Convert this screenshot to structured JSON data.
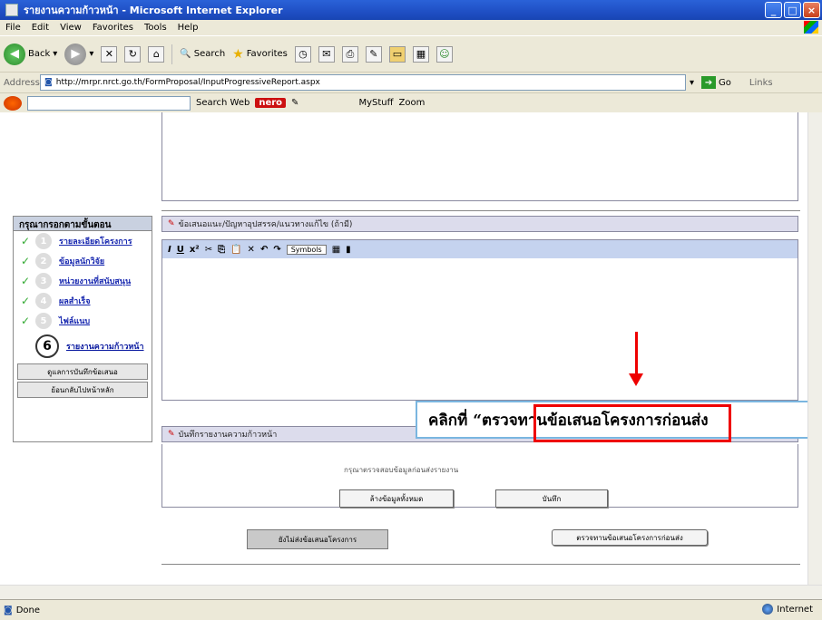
{
  "window": {
    "title": "รายงานความก้าวหน้า - Microsoft Internet Explorer",
    "buttons": [
      "_",
      "□",
      "×"
    ]
  },
  "menu": [
    "File",
    "Edit",
    "View",
    "Favorites",
    "Tools",
    "Help"
  ],
  "toolbar": {
    "back": "Back",
    "search": "Search",
    "favorites": "Favorites"
  },
  "address": {
    "label": "Address",
    "url": "http://mrpr.nrct.go.th/FormProposal/InputProgressiveReport.aspx",
    "go": "Go",
    "links": "Links"
  },
  "searchbar": {
    "search_web": "Search Web",
    "nero": "nero",
    "mystuff": "MyStuff",
    "zoom": "Zoom"
  },
  "steps": {
    "title": "กรุณากรอกตามขั้นตอน",
    "items": [
      {
        "num": "1",
        "label": "รายละเอียดโครงการ"
      },
      {
        "num": "2",
        "label": "ข้อมูลนักวิจัย"
      },
      {
        "num": "3",
        "label": "หน่วยงานที่สนับสนุน"
      },
      {
        "num": "4",
        "label": "ผลสำเร็จ"
      },
      {
        "num": "5",
        "label": "ไฟล์แนบ"
      },
      {
        "num": "6",
        "label": "รายงานความก้าวหน้า"
      }
    ],
    "btn_save_all": "ดูแลการบันทึกข้อเสนอ",
    "btn_back_main": "ย้อนกลับไปหน้าหลัก"
  },
  "form": {
    "section_problems": "ข้อเสนอแนะ/ปัญหาอุปสรรค/แนวทางแก้ไข (ถ้ามี)",
    "symbols": "Symbols",
    "section_report": "บันทึกรายงานความก้าวหน้า",
    "report_note": "กรุณาตรวจสอบข้อมูลก่อนส่งรายงาน",
    "btn_clear": "ล้างข้อมูลทั้งหมด",
    "btn_save": "บันทึก",
    "btn_not_submit": "ยังไม่ส่งข้อเสนอโครงการ",
    "btn_check": "ตรวจทานข้อเสนอโครงการก่อนส่ง"
  },
  "callout": {
    "text": "คลิกที่ “ตรวจทานข้อเสนอโครงการก่อนส่ง"
  },
  "status": {
    "left": "Done",
    "zone": "Internet"
  },
  "colors": {
    "title_blue": "#2a62d8",
    "highlight_red": "#e00000",
    "callout_border": "#7ab6e0"
  }
}
